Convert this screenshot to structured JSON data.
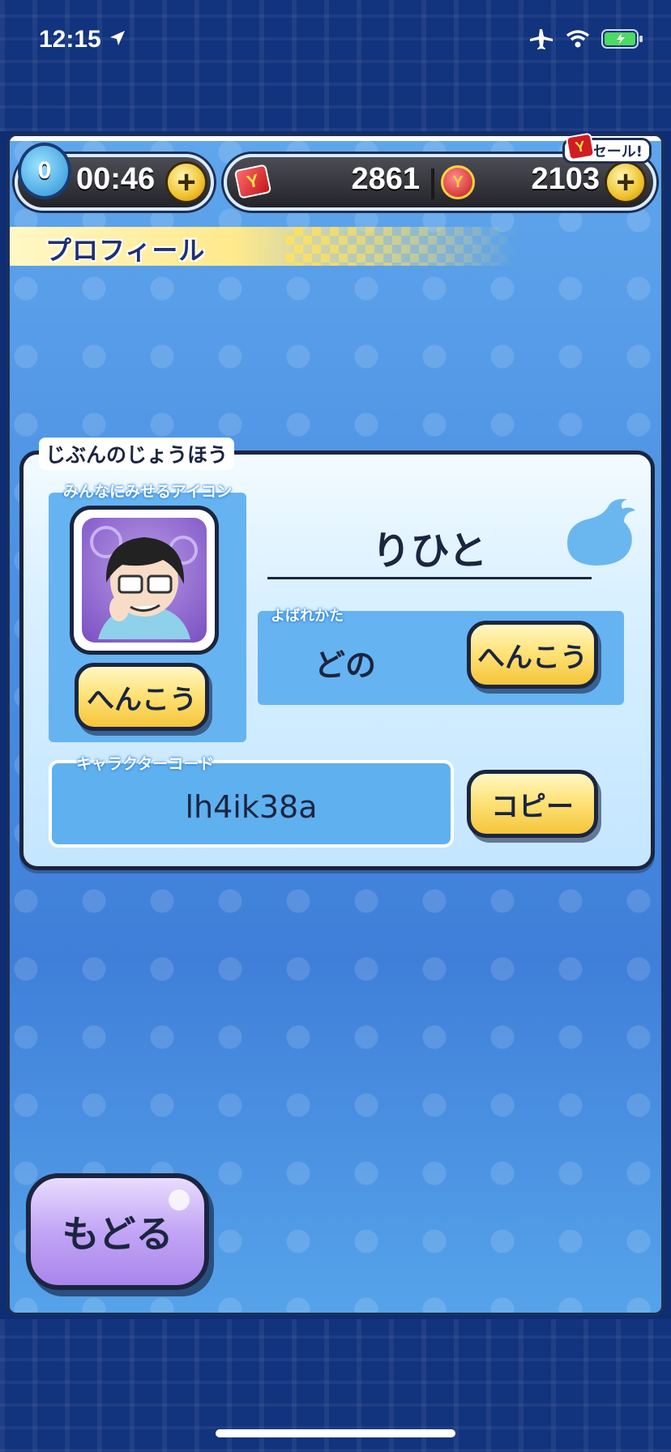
{
  "status_bar": {
    "time": "12:15"
  },
  "currency": {
    "timer_count": "0",
    "timer": "00:46",
    "ycard_amount": "2861",
    "coin_amount": "2103",
    "sale_label": "セール!"
  },
  "screen": {
    "title": "プロフィール"
  },
  "profile": {
    "section_label": "じぶんのじょうほう",
    "icon_label": "みんなにみせるアイコン",
    "icon_change_label": "へんこう",
    "name": "りひと",
    "call_label": "よばれかた",
    "call_value": "どの",
    "call_change_label": "へんこう",
    "code_label": "キャラクターコード",
    "code_value": "lh4ik38a",
    "copy_label": "コピー"
  },
  "footer": {
    "back_label": "もどる"
  },
  "colors": {
    "ink": "#1b2540",
    "panel_blue": "#4b8fe2",
    "button_yellow": "#ffe37a",
    "back_purple": "#c2a5f5"
  }
}
